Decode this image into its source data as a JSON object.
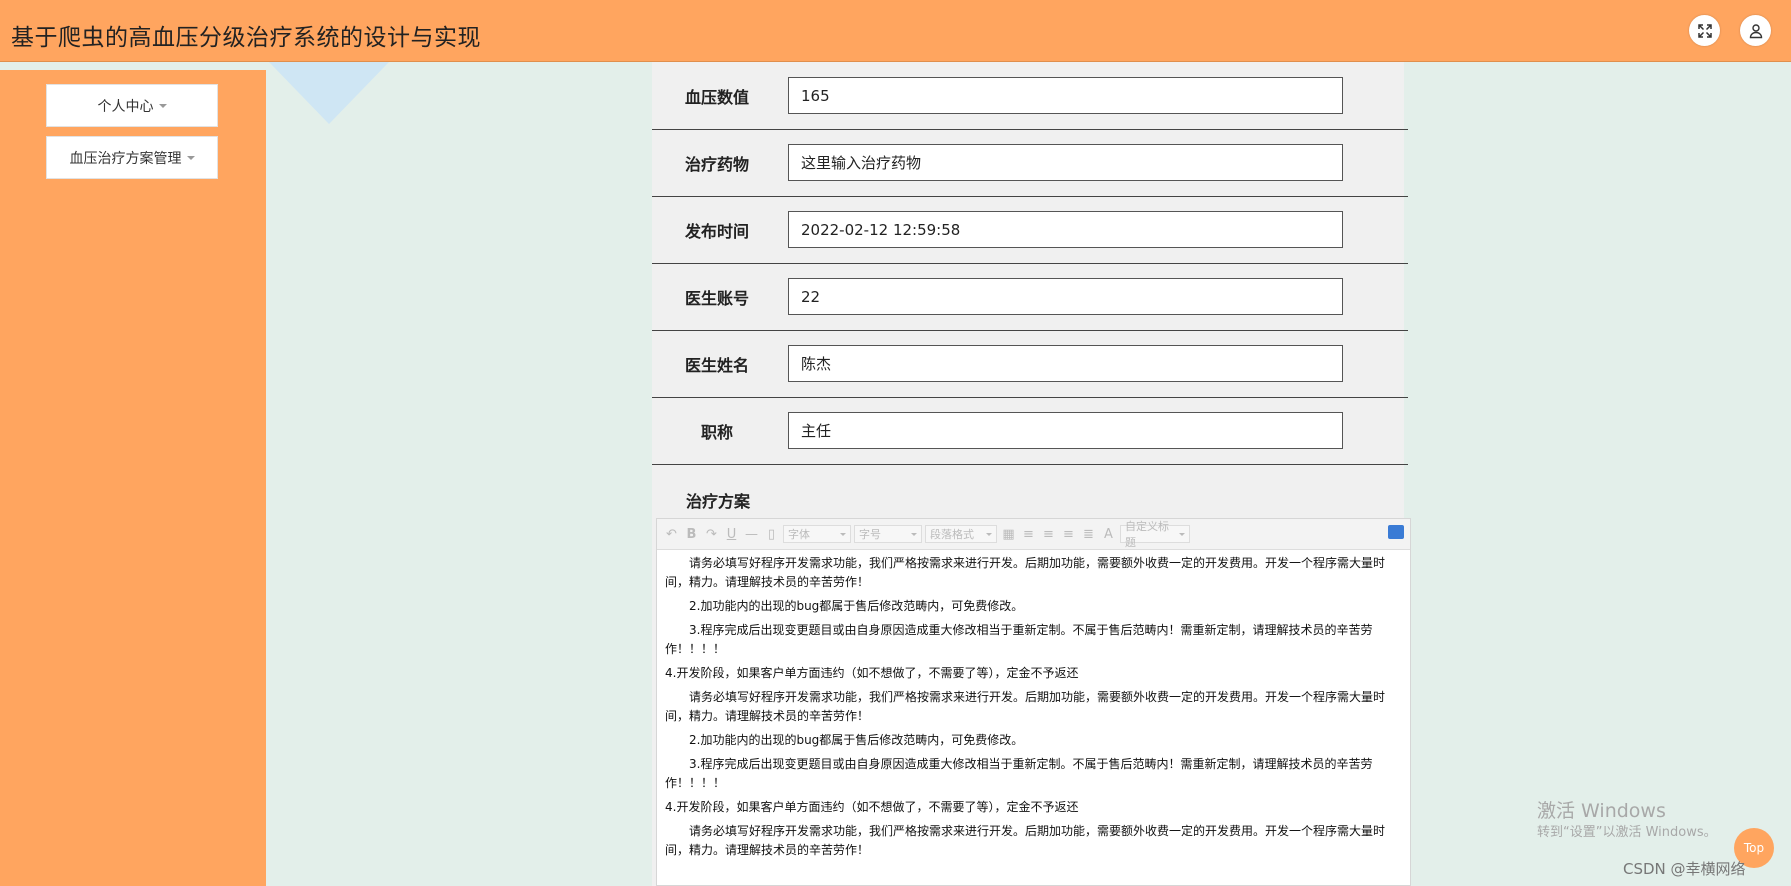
{
  "header": {
    "title": "基于爬虫的高血压分级治疗系统的设计与实现",
    "fullscreen_icon": "expand-icon",
    "user_icon": "user-icon",
    "background_color": "#ffa55f"
  },
  "sidebar": {
    "items": [
      {
        "label": "个人中心"
      },
      {
        "label": "血压治疗方案管理"
      }
    ]
  },
  "form": {
    "fields": [
      {
        "label": "血压数值",
        "value": "165"
      },
      {
        "label": "治疗药物",
        "value": "这里输入治疗药物"
      },
      {
        "label": "发布时间",
        "value": "2022-02-12 12:59:58"
      },
      {
        "label": "医生账号",
        "value": "22"
      },
      {
        "label": "医生姓名",
        "value": "陈杰"
      },
      {
        "label": "职称",
        "value": "主任"
      }
    ],
    "plan_label": "治疗方案"
  },
  "editor": {
    "toolbar": {
      "font": "字体",
      "size": "字号",
      "paragraph": "段落格式",
      "custom_title": "自定义标题"
    },
    "paragraphs": [
      {
        "text": "请务必填写好程序开发需求功能，我们严格按需求来进行开发。后期加功能，需要额外收费一定的开发费用。开发一个程序需大量时间，精力。请理解技术员的辛苦劳作！",
        "indent": true
      },
      {
        "text": "2.加功能内的出现的bug都属于售后修改范畴内，可免费修改。",
        "indent": true
      },
      {
        "text": "3.程序完成后出现变更题目或由自身原因造成重大修改相当于重新定制。不属于售后范畴内！需重新定制，请理解技术员的辛苦劳作！！！！",
        "indent": true
      },
      {
        "text": "4.开发阶段，如果客户单方面违约（如不想做了，不需要了等），定金不予返还",
        "indent": false
      },
      {
        "text": "请务必填写好程序开发需求功能，我们严格按需求来进行开发。后期加功能，需要额外收费一定的开发费用。开发一个程序需大量时间，精力。请理解技术员的辛苦劳作！",
        "indent": true
      },
      {
        "text": "2.加功能内的出现的bug都属于售后修改范畴内，可免费修改。",
        "indent": true
      },
      {
        "text": "3.程序完成后出现变更题目或由自身原因造成重大修改相当于重新定制。不属于售后范畴内！需重新定制，请理解技术员的辛苦劳作！！！！",
        "indent": true
      },
      {
        "text": "4.开发阶段，如果客户单方面违约（如不想做了，不需要了等），定金不予返还",
        "indent": false
      },
      {
        "text": "请务必填写好程序开发需求功能，我们严格按需求来进行开发。后期加功能，需要额外收费一定的开发费用。开发一个程序需大量时间，精力。请理解技术员的辛苦劳作！",
        "indent": true
      }
    ]
  },
  "top_button": "Top",
  "watermark": {
    "title": "激活 Windows",
    "subtitle": "转到“设置”以激活 Windows。"
  },
  "csdn": "CSDN @幸横网络"
}
